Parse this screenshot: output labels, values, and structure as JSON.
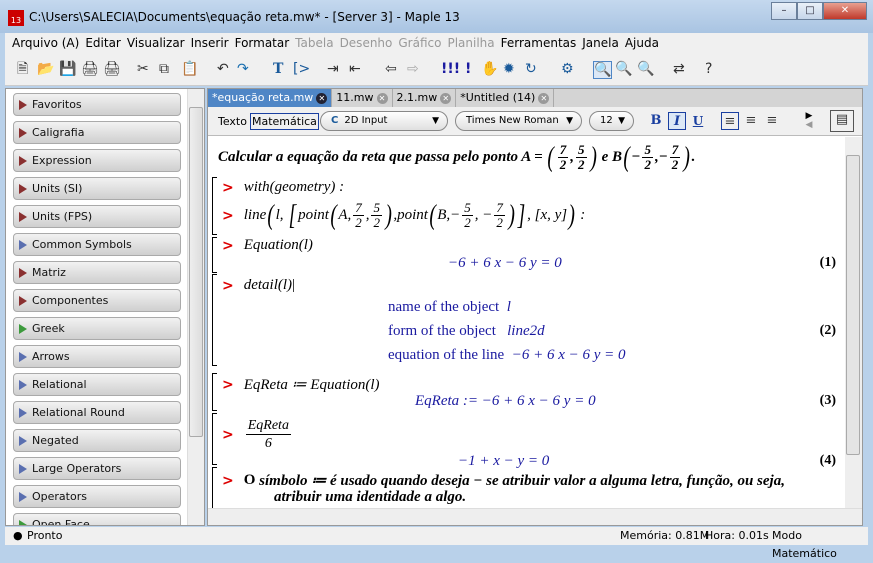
{
  "window": {
    "title": "C:\\Users\\SALECIA\\Documents\\equação reta.mw* - [Server 3] - Maple 13",
    "icon_text": "13",
    "buttons": [
      "minimize",
      "maximize",
      "close"
    ]
  },
  "menu": [
    {
      "label": "Arquivo (A)",
      "enabled": true
    },
    {
      "label": "Editar",
      "enabled": true
    },
    {
      "label": "Visualizar",
      "enabled": true
    },
    {
      "label": "Inserir",
      "enabled": true
    },
    {
      "label": "Formatar",
      "enabled": true
    },
    {
      "label": "Tabela",
      "enabled": false
    },
    {
      "label": "Desenho",
      "enabled": false
    },
    {
      "label": "Gráfico",
      "enabled": false
    },
    {
      "label": "Planilha",
      "enabled": false
    },
    {
      "label": "Ferramentas",
      "enabled": true
    },
    {
      "label": "Janela",
      "enabled": true
    },
    {
      "label": "Ajuda",
      "enabled": true
    }
  ],
  "toolbar": [
    "new-icon",
    "open-icon",
    "save-icon",
    "print-icon",
    "print-preview-icon",
    "cut-icon",
    "copy-icon",
    "paste-icon",
    "undo-icon",
    "redo-icon",
    "text-icon",
    "math-input-icon",
    "indent-icon",
    "outdent-icon",
    "back-icon",
    "forward-icon",
    "execute-all-icon",
    "execute-icon",
    "stop-icon",
    "debug-icon",
    "restart-icon",
    "settings-icon",
    "zoom-fit-icon",
    "zoom-in-icon",
    "zoom-out-icon",
    "toggle-icon",
    "help-icon"
  ],
  "palettes": [
    {
      "label": "Favoritos",
      "color": "red"
    },
    {
      "label": "Caligrafia",
      "color": "red"
    },
    {
      "label": "Expression",
      "color": "red"
    },
    {
      "label": "Units (SI)",
      "color": "red"
    },
    {
      "label": "Units (FPS)",
      "color": "red"
    },
    {
      "label": "Common Symbols",
      "color": "blue"
    },
    {
      "label": "Matriz",
      "color": "red"
    },
    {
      "label": "Componentes",
      "color": "red"
    },
    {
      "label": "Greek",
      "color": "green"
    },
    {
      "label": "Arrows",
      "color": "blue"
    },
    {
      "label": "Relational",
      "color": "blue"
    },
    {
      "label": "Relational Round",
      "color": "blue"
    },
    {
      "label": "Negated",
      "color": "blue"
    },
    {
      "label": "Large Operators",
      "color": "blue"
    },
    {
      "label": "Operators",
      "color": "blue"
    },
    {
      "label": "Open Face",
      "color": "green"
    }
  ],
  "tabs": [
    {
      "label": "*equação reta.mw",
      "active": true
    },
    {
      "label": "11.mw"
    },
    {
      "label": "2.1.mw"
    },
    {
      "label": "*Untitled (14)"
    }
  ],
  "format": {
    "texto": "Texto",
    "matematica": "Matemática",
    "input_mode": "2D Input",
    "input_mode_icon": "C",
    "font": "Times New Roman",
    "size": "12",
    "bold": "B",
    "italic": "I",
    "underline": "U",
    "italic_active": true
  },
  "doc": {
    "intro": {
      "text": "Calcular a equação da reta que passa pelo ponto A =",
      "a": [
        "7",
        "2",
        "5",
        "2"
      ],
      "mid": "e B",
      "b": [
        "5",
        "2",
        "7",
        "2"
      ]
    },
    "cmd1": "with(geometry) :",
    "cmd2": {
      "pre": "line",
      "l": "l,",
      "point": "point",
      "A": "A,",
      "a": [
        "7",
        "2",
        "5",
        "2"
      ],
      "B": "B,",
      "b": [
        "5",
        "2",
        "7",
        "2"
      ],
      "xy": "[x, y]",
      "end": ":"
    },
    "cmd3": "Equation(l)",
    "out1": "−6 + 6 x − 6 y = 0",
    "eq1": "(1)",
    "cmd4": "detail(l)",
    "detail": [
      {
        "k": "name of the object",
        "v": "l"
      },
      {
        "k": "form of the object",
        "v": "line2d"
      },
      {
        "k": "equation of the line",
        "v": "−6 + 6 x − 6 y = 0"
      }
    ],
    "eq2": "(2)",
    "cmd5": "EqReta ≔ Equation(l)",
    "out3": "EqReta := −6 + 6 x − 6 y = 0",
    "eq3": "(3)",
    "cmd6": {
      "num": "EqReta",
      "den": "6"
    },
    "out4": "−1 + x − y = 0",
    "eq4": "(4)",
    "note1a": "O",
    "note1b": "símbolo ≔ é usado quando deseja − se atribuir valor a alguma letra, função, ou seja,",
    "note2": "atribuir uma identidade a algo."
  },
  "status": {
    "left": "Pronto",
    "memory": "Memória: 0.81M",
    "time": "Hora: 0.01s",
    "mode": "Modo Matemático"
  }
}
